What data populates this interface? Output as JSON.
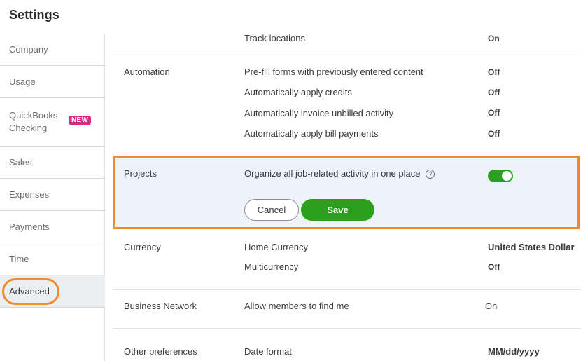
{
  "page": {
    "title": "Settings"
  },
  "sidebar": {
    "items": [
      {
        "label": "Company"
      },
      {
        "label": "Usage"
      },
      {
        "label_line1": "QuickBooks",
        "label_line2": "Checking",
        "badge": "NEW"
      },
      {
        "label": "Sales"
      },
      {
        "label": "Expenses"
      },
      {
        "label": "Payments"
      },
      {
        "label": "Time"
      },
      {
        "label": "Advanced",
        "active": true
      }
    ]
  },
  "sections": {
    "track_locations": {
      "label": "Track locations",
      "value": "On"
    },
    "automation": {
      "title": "Automation",
      "rows": [
        {
          "label": "Pre-fill forms with previously entered content",
          "value": "Off"
        },
        {
          "label": "Automatically apply credits",
          "value": "Off"
        },
        {
          "label": "Automatically invoice unbilled activity",
          "value": "Off"
        },
        {
          "label": "Automatically apply bill payments",
          "value": "Off"
        }
      ]
    },
    "projects": {
      "title": "Projects",
      "label": "Organize all job-related activity in one place",
      "help_glyph": "?",
      "toggle_on": true,
      "cancel_label": "Cancel",
      "save_label": "Save"
    },
    "currency": {
      "title": "Currency",
      "rows": [
        {
          "label": "Home Currency",
          "value": "United States Dollar"
        },
        {
          "label": "Multicurrency",
          "value": "Off"
        }
      ]
    },
    "business_network": {
      "title": "Business Network",
      "label": "Allow members to find me",
      "value": "On"
    },
    "other_preferences": {
      "title": "Other preferences",
      "label": "Date format",
      "value": "MM/dd/yyyy"
    }
  },
  "colors": {
    "accent_green": "#2ca01c",
    "highlight_orange": "#ee8b2f",
    "badge_pink": "#d52b84",
    "panel_blue": "#eef3fb"
  }
}
